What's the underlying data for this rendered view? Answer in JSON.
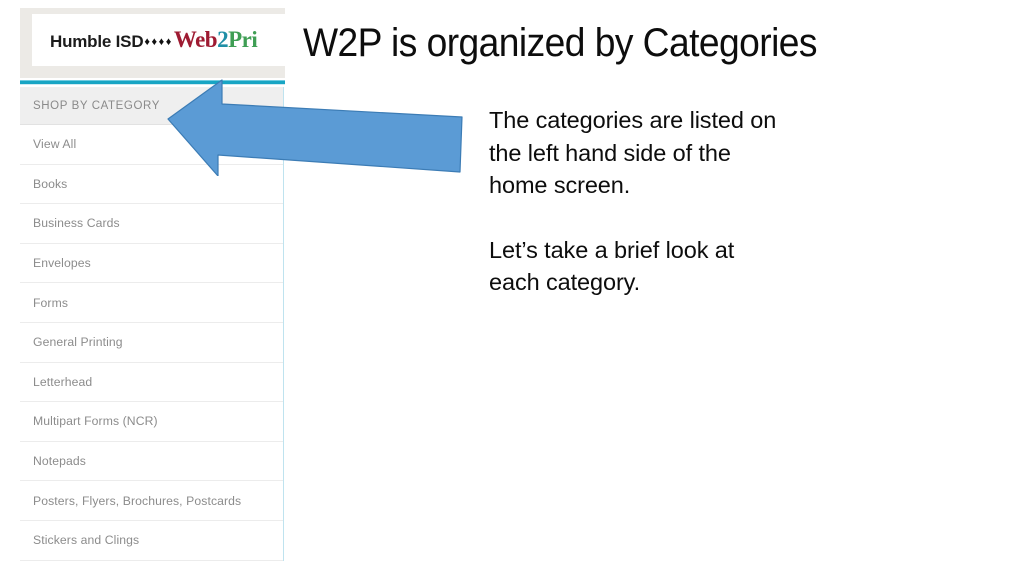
{
  "slide": {
    "title": "W2P is organized by Categories",
    "body_paragraphs": [
      "The categories are listed on the left hand side of the home screen.",
      "Let’s take a brief look at each category."
    ]
  },
  "screenshot": {
    "logo": {
      "org_name": "Humble ISD",
      "separator": "♦♦♦♦",
      "brand_part1": "Web",
      "brand_part2": "2",
      "brand_part3": "Pri",
      "colors": {
        "brand_part1": "#9e1b32",
        "brand_part2": "#1f8fa6",
        "brand_part3": "#3f9e54",
        "org_name": "#1b1b1b",
        "band_background": "#eceae6"
      }
    },
    "accent_rule_color": "#18a5c4",
    "category_panel": {
      "header": "SHOP BY CATEGORY",
      "header_background": "#efefef",
      "item_text_color": "#8c8c8c",
      "items": [
        {
          "label": "View All"
        },
        {
          "label": "Books"
        },
        {
          "label": "Business Cards"
        },
        {
          "label": "Envelopes"
        },
        {
          "label": "Forms"
        },
        {
          "label": "General Printing"
        },
        {
          "label": "Letterhead"
        },
        {
          "label": "Multipart Forms (NCR)"
        },
        {
          "label": "Notepads"
        },
        {
          "label": "Posters, Flyers, Brochures, Postcards"
        },
        {
          "label": "Stickers and Clings"
        }
      ]
    }
  },
  "annotation": {
    "arrow": {
      "direction": "left",
      "fill_color": "#5b9bd5",
      "stroke_color": "#3c7cb5"
    }
  }
}
